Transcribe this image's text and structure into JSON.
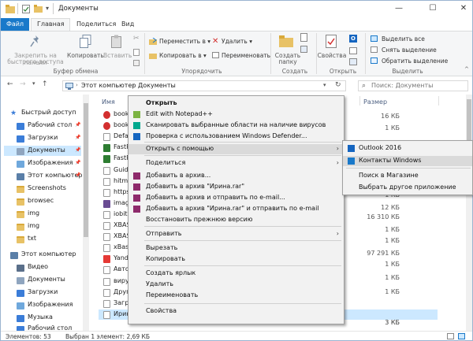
{
  "window": {
    "title": "Документы"
  },
  "ribbon_tabs": {
    "file": "Файл",
    "home": "Главная",
    "share": "Поделиться",
    "view": "Вид"
  },
  "ribbon": {
    "pin": "Закрепить на панели быстрого доступа",
    "pin_l1": "Закрепить на панели",
    "pin_l2": "быстрого доступа",
    "copy": "Копировать",
    "paste": "Вставить",
    "clipboard_group": "Буфер обмена",
    "move_to": "Переместить в",
    "copy_to": "Копировать в",
    "delete": "Удалить",
    "rename": "Переименовать",
    "organize_group": "Упорядочить",
    "new_folder_l1": "Создать",
    "new_folder_l2": "папку",
    "create_group": "Создать",
    "properties": "Свойства",
    "open_group": "Открыть",
    "select_all": "Выделить все",
    "select_none": "Снять выделение",
    "invert_selection": "Обратить выделение",
    "select_group": "Выделить"
  },
  "address": {
    "crumbs": [
      "Этот компьютер",
      "Документы"
    ],
    "search_placeholder": "Поиск: Документы"
  },
  "nav": {
    "items": [
      {
        "label": "Быстрый доступ",
        "icon": "star-icon"
      },
      {
        "label": "Рабочий стол",
        "icon": "desktop-icon"
      },
      {
        "label": "Загрузки",
        "icon": "download-icon"
      },
      {
        "label": "Документы",
        "icon": "documents-icon",
        "selected": true
      },
      {
        "label": "Изображения",
        "icon": "pictures-icon"
      },
      {
        "label": "Этот компьютер",
        "icon": "computer-icon"
      },
      {
        "label": "Screenshots",
        "icon": "folder-icon"
      },
      {
        "label": "browsec",
        "icon": "folder-icon"
      },
      {
        "label": "img",
        "icon": "folder-icon"
      },
      {
        "label": "img",
        "icon": "folder-icon"
      },
      {
        "label": "txt",
        "icon": "folder-icon"
      },
      {
        "label": "Этот компьютер",
        "icon": "computer-icon"
      },
      {
        "label": "Видео",
        "icon": "video-icon"
      },
      {
        "label": "Документы",
        "icon": "documents-icon"
      },
      {
        "label": "Загрузки",
        "icon": "download-icon"
      },
      {
        "label": "Изображения",
        "icon": "pictures-icon"
      },
      {
        "label": "Музыка",
        "icon": "music-icon"
      },
      {
        "label": "Рабочий стол",
        "icon": "desktop-icon"
      }
    ]
  },
  "columns": {
    "name": "Имя",
    "size": "Размер"
  },
  "files": [
    {
      "name": "bookm",
      "size": "",
      "icon": "opera-icon"
    },
    {
      "name": "bookm",
      "size": "16 КБ",
      "icon": "opera-icon"
    },
    {
      "name": "Defau",
      "size": "1 КБ",
      "icon": "file-icon"
    },
    {
      "name": "FastR",
      "size": "",
      "icon": "fastreport-icon"
    },
    {
      "name": "FastR",
      "size": "",
      "icon": "fastreport-icon"
    },
    {
      "name": "Guide",
      "size": "",
      "icon": "file-icon"
    },
    {
      "name": "hitma",
      "size": "",
      "icon": "file-icon"
    },
    {
      "name": "https.",
      "size": "",
      "icon": "file-icon"
    },
    {
      "name": "image",
      "size": "",
      "icon": "image-icon"
    },
    {
      "name": "iobitu",
      "size": "",
      "icon": "file-icon"
    },
    {
      "name": "XBASI",
      "size": "",
      "icon": "file-icon"
    },
    {
      "name": "XBASI",
      "size": "",
      "icon": "file-icon"
    },
    {
      "name": "xBase",
      "size": "",
      "icon": "file-icon"
    },
    {
      "name": "Yande",
      "size": "",
      "icon": "yandex-icon"
    },
    {
      "name": "Автос",
      "size": "",
      "icon": "file-icon"
    },
    {
      "name": "вирус",
      "size": "",
      "icon": "file-icon"
    },
    {
      "name": "Други",
      "size": "",
      "icon": "file-icon"
    },
    {
      "name": "Загру",
      "size": "",
      "icon": "file-icon"
    },
    {
      "name": "Ирина",
      "size": "3 КБ",
      "icon": "file-icon",
      "selected": true
    }
  ],
  "right_sizes": [
    "16 КБ",
    "1 КБ",
    "3 КБ",
    "2 КБ",
    "1 КБ",
    "12 КБ",
    "16 310 КБ",
    "1 КБ",
    "1 КБ",
    "97 291 КБ",
    "1 КБ",
    "1 КБ",
    "1 КБ"
  ],
  "status": {
    "count": "Элементов: 53",
    "selected": "Выбран 1 элемент: 2,69 КБ"
  },
  "context_menu": [
    {
      "label": "Открыть",
      "bold": true,
      "icon": ""
    },
    {
      "label": "Edit with Notepad++",
      "icon": "notepadpp-icon"
    },
    {
      "label": "Сканировать выбранные области на наличие вирусов",
      "icon": "kaspersky-icon"
    },
    {
      "label": "Проверка с использованием Windows Defender...",
      "icon": "defender-icon"
    },
    {
      "label": "Открыть с помощью",
      "icon": "",
      "submenu": true,
      "selected": true
    },
    {
      "label": "Поделиться",
      "icon": "",
      "submenu": true
    },
    {
      "label": "Добавить в архив...",
      "icon": "winrar-icon"
    },
    {
      "label": "Добавить в архив \"Ирина.rar\"",
      "icon": "winrar-icon"
    },
    {
      "label": "Добавить в архив и отправить по e-mail...",
      "icon": "winrar-icon"
    },
    {
      "label": "Добавить в архив \"Ирина.rar\" и отправить по e-mail",
      "icon": "winrar-icon"
    },
    {
      "label": "Восстановить прежнюю версию",
      "icon": ""
    },
    {
      "label": "Отправить",
      "icon": "",
      "submenu": true
    },
    {
      "label": "Вырезать",
      "icon": ""
    },
    {
      "label": "Копировать",
      "icon": ""
    },
    {
      "label": "Создать ярлык",
      "icon": ""
    },
    {
      "label": "Удалить",
      "icon": ""
    },
    {
      "label": "Переименовать",
      "icon": ""
    },
    {
      "label": "Свойства",
      "icon": ""
    }
  ],
  "open_with_menu": [
    {
      "label": "Outlook 2016",
      "icon": "outlook-icon"
    },
    {
      "label": "Контакты Windows",
      "icon": "contacts-icon",
      "selected": true
    },
    {
      "label": "Поиск в Магазине",
      "icon": ""
    },
    {
      "label": "Выбрать другое приложение",
      "icon": ""
    }
  ],
  "colors": {
    "accent": "#1979ca",
    "selection": "#cce8ff",
    "menu_bg": "#f2f2f2"
  }
}
